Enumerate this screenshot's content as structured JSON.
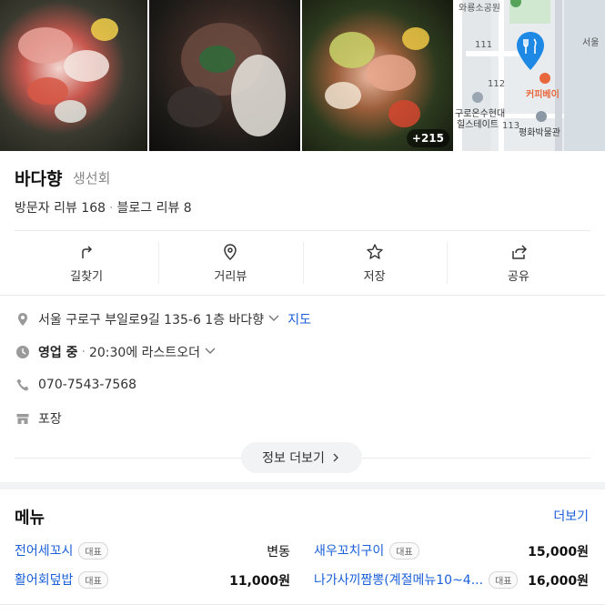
{
  "photos": {
    "more_count": "+215"
  },
  "map": {
    "labels": {
      "park": "와룡소공원",
      "seoul": "서울",
      "n111": "111",
      "n112": "112",
      "n113": "113",
      "apt1": "구로온수현대",
      "apt2": "힐스테이트",
      "cafe": "커피베이",
      "museum": "평화박물관"
    }
  },
  "place": {
    "name": "바다향",
    "category": "생선회",
    "visitor_reviews": "방문자 리뷰 168",
    "blog_reviews": "블로그 리뷰 8"
  },
  "actions": [
    {
      "label": "길찾기",
      "icon": "directions-icon"
    },
    {
      "label": "거리뷰",
      "icon": "street-view-icon"
    },
    {
      "label": "저장",
      "icon": "star-icon"
    },
    {
      "label": "공유",
      "icon": "share-icon"
    }
  ],
  "info": {
    "address": "서울 구로구 부일로9길 135-6 1층 바다향",
    "map_link": "지도",
    "hours_status": "영업 중",
    "hours_detail": "20:30에 라스트오더",
    "phone": "070-7543-7568",
    "service": "포장",
    "more_info_label": "정보 더보기"
  },
  "menu": {
    "title": "메뉴",
    "more_label": "더보기",
    "items": [
      {
        "name": "전어세꼬시",
        "badge": "대표",
        "price": "변동"
      },
      {
        "name": "새우꼬치구이",
        "badge": "대표",
        "price": "15,000원"
      },
      {
        "name": "활어회덮밥",
        "badge": "대표",
        "price": "11,000원"
      },
      {
        "name": "나가사끼짬뽕(계절메뉴10~4...",
        "badge": "대표",
        "price": "16,000원"
      }
    ]
  },
  "colors": {
    "link_blue": "#1a5fd9",
    "map_pin": "#1e88e5",
    "brand_orange": "#e8673d"
  }
}
